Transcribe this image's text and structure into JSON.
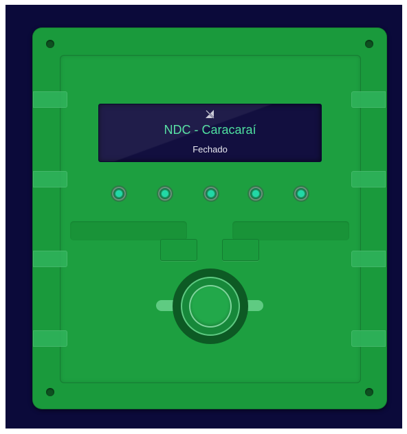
{
  "device": {
    "display": {
      "icon": "signal-off-icon",
      "title": "NDC - Caracaraí",
      "status": "Fechado"
    },
    "leds": [
      "led-1",
      "led-2",
      "led-3",
      "led-4",
      "led-5"
    ],
    "colors": {
      "background": "#0b0a3a",
      "panel": "#1a9a3c",
      "display": "#120f3f",
      "title_text": "#4fe0a0",
      "led": "#22d8a6"
    }
  }
}
